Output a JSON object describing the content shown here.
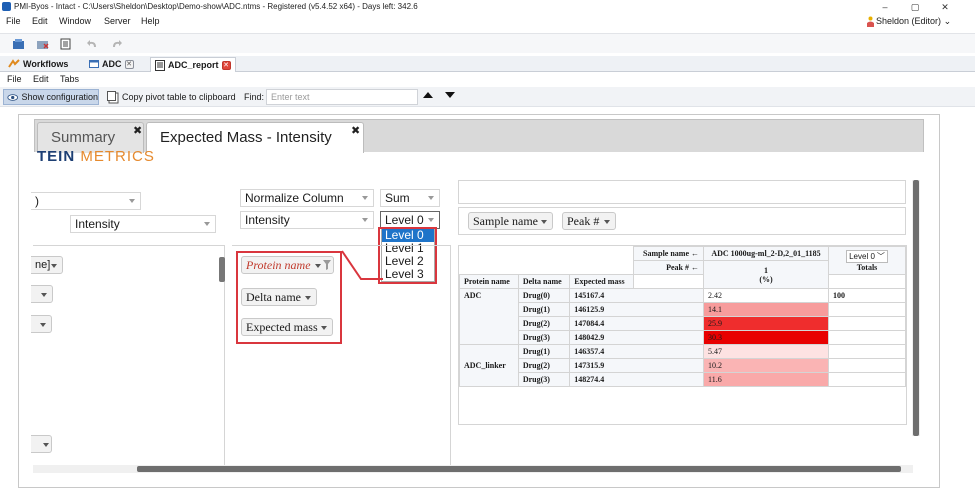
{
  "titlebar": {
    "text": "PMI-Byos - Intact - C:\\Users\\Sheldon\\Desktop\\Demo-show\\ADC.ntms - Registered (v5.4.52 x64) - Days left: 342.6",
    "minimize": "–",
    "maximize": "▢",
    "close": "✕"
  },
  "menubar": {
    "items": [
      "File",
      "Edit",
      "Window",
      "Server",
      "Help"
    ],
    "user": "Sheldon (Editor)"
  },
  "editor_tabs": [
    {
      "label": "Workflows",
      "closable": false
    },
    {
      "label": "ADC",
      "closable": true
    },
    {
      "label": "ADC_report",
      "closable": true
    }
  ],
  "report_menu": {
    "items": [
      "File",
      "Edit",
      "Tabs"
    ]
  },
  "report_toolbar": {
    "show_config": "Show configuration",
    "copy_pivot": "Copy pivot table to clipboard",
    "find_label": "Find:",
    "find_placeholder": "Enter text"
  },
  "inner_tabs": [
    {
      "label": "Summary",
      "close": "✖"
    },
    {
      "label": "Expected Mass - Intensity",
      "close": "✖"
    }
  ],
  "logo": {
    "part1": "TEIN ",
    "part2": "METRICS"
  },
  "config": {
    "left_select_1": ")",
    "left_select_2": "Intensity",
    "left_pill_1": "ne]",
    "normalize": "Normalize Column",
    "aggregator": "Sum",
    "value_field": "Intensity",
    "level_select": "Level 0",
    "level_options": [
      "Level 0",
      "Level 1",
      "Level 2",
      "Level 3"
    ],
    "row_fields": [
      "Protein name",
      "Delta name",
      "Expected mass"
    ],
    "col_fields": [
      "Sample name",
      "Peak #"
    ]
  },
  "table": {
    "sample_name_header": "Sample name ←",
    "peak_header": "Peak # ←",
    "column_label": "ADC 1000ug-ml_2-D,2_01_1185",
    "peak_value": "1",
    "unit": "(%)",
    "totals_level": "Level 0",
    "totals_label": "Totals",
    "row_headers": [
      "Protein name",
      "Delta name",
      "Expected mass"
    ],
    "rows": [
      {
        "protein": "ADC",
        "delta": "Drug(0)",
        "mass": "145167.4",
        "value": "2.42",
        "color": "#ffffff",
        "total": "100"
      },
      {
        "protein": "",
        "delta": "Drug(1)",
        "mass": "146125.9",
        "value": "14.1",
        "color": "#f79c9c",
        "total": ""
      },
      {
        "protein": "",
        "delta": "Drug(2)",
        "mass": "147084.4",
        "value": "25.9",
        "color": "#ef2d2d",
        "total": ""
      },
      {
        "protein": "",
        "delta": "Drug(3)",
        "mass": "148042.9",
        "value": "30.3",
        "color": "#e80000",
        "total": ""
      },
      {
        "protein": "ADC_linker",
        "delta": "Drug(1)",
        "mass": "146357.4",
        "value": "5.47",
        "color": "#fde2e2",
        "total": ""
      },
      {
        "protein": "",
        "delta": "Drug(2)",
        "mass": "147315.9",
        "value": "10.2",
        "color": "#fab4b4",
        "total": ""
      },
      {
        "protein": "",
        "delta": "Drug(3)",
        "mass": "148274.4",
        "value": "11.6",
        "color": "#f9a9a9",
        "total": ""
      }
    ]
  },
  "colors": {
    "highlight_red": "#d9363e",
    "selection_blue": "#1e74c9",
    "logo_navy": "#1d3f74",
    "logo_orange": "#e68a2e"
  }
}
